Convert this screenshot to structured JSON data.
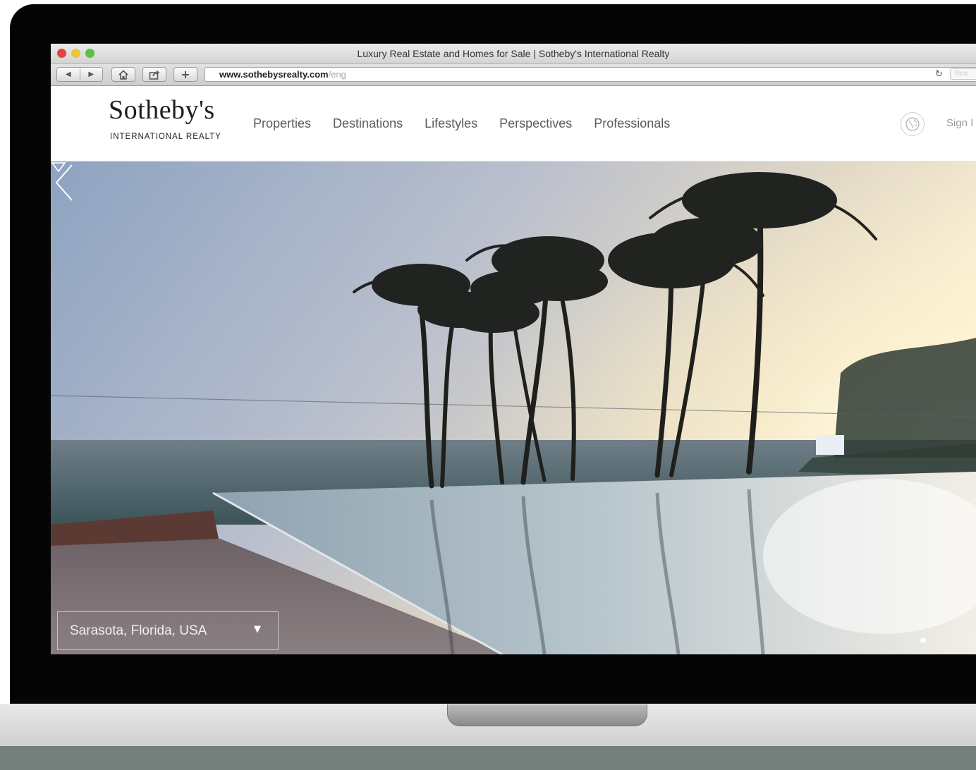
{
  "browser": {
    "window_title": "Luxury Real Estate and Homes for Sale | Sotheby's International Realty",
    "url_host": "www.sothebysrealty.com",
    "url_path": "/eng",
    "reader_label": "Rea"
  },
  "site": {
    "logo_name": "Sotheby's",
    "logo_sub": "INTERNATIONAL REALTY",
    "nav": [
      "Properties",
      "Destinations",
      "Lifestyles",
      "Perspectives",
      "Professionals"
    ],
    "sign_in": "Sign I"
  },
  "hero": {
    "location": "Sarasota, Florida, USA"
  },
  "icons": {
    "traffic_lights": [
      "close-icon",
      "minimize-icon",
      "maximize-icon"
    ],
    "toolbar": [
      "back-icon",
      "forward-icon",
      "home-icon",
      "share-icon",
      "add-icon",
      "reload-icon"
    ],
    "header": [
      "globe-icon"
    ],
    "hero": [
      "chevron-left-icon",
      "caret-down-icon",
      "triangle-down-icon"
    ]
  },
  "colors": {
    "laptop_bezel": "#050505",
    "close": "#e3453b",
    "minimize": "#eec33a",
    "maximize": "#5bc13e",
    "nav_text": "#5a5a5a",
    "logo_text": "#1e1e1e"
  }
}
